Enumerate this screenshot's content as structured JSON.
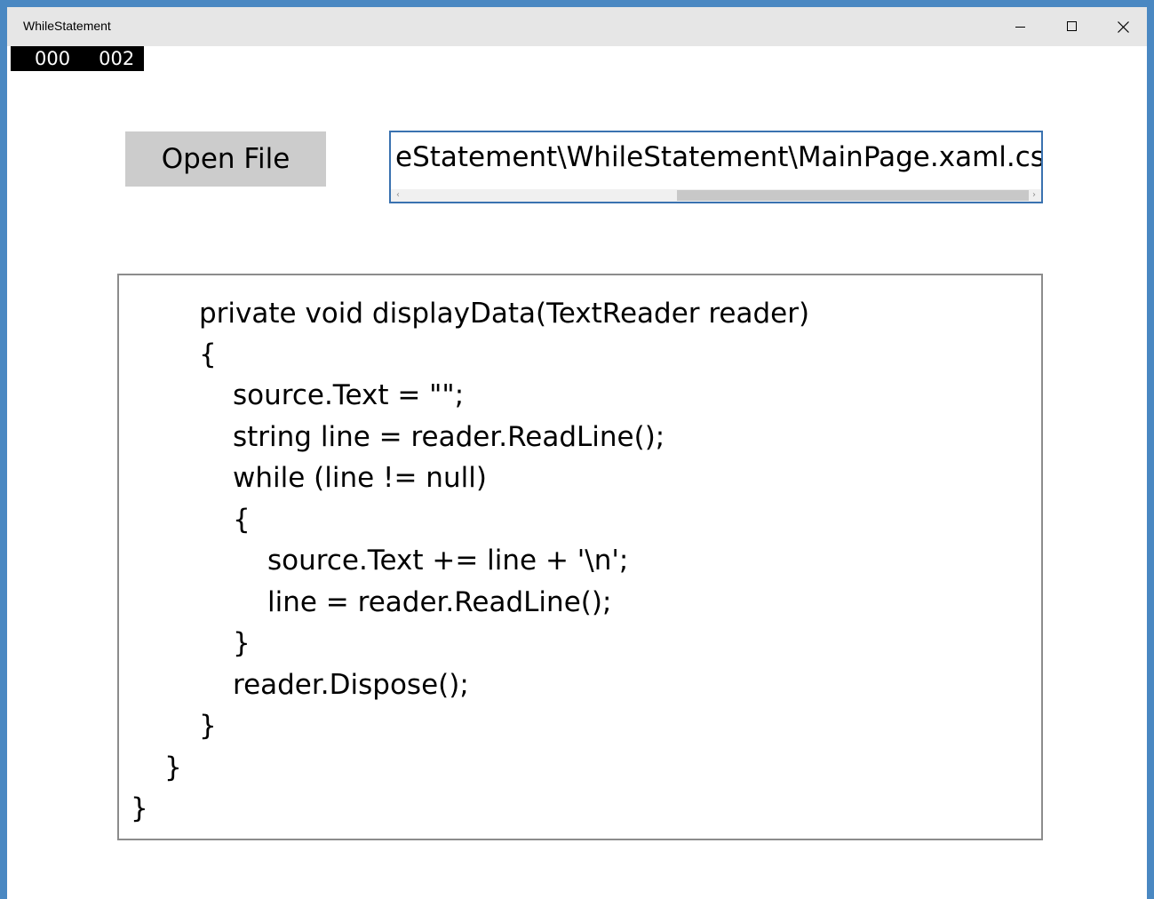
{
  "window": {
    "title": "WhileStatement"
  },
  "caption_buttons": {
    "minimize_icon": "minimize-icon",
    "maximize_icon": "maximize-icon",
    "close_icon": "close-icon"
  },
  "frame_counter": {
    "left_value": "000",
    "right_value": "002"
  },
  "toolbar": {
    "open_file_label": "Open File"
  },
  "file_path": {
    "value": "eStatement\\WhileStatement\\MainPage.xaml.cs"
  },
  "code": {
    "lines": [
      "private void displayData(TextReader reader)",
      "{",
      "source.Text = \"\";",
      "string line = reader.ReadLine();",
      "while (line != null)",
      "{",
      "source.Text += line + '\\n';",
      "line = reader.ReadLine();",
      "}",
      "reader.Dispose();",
      "}",
      "}",
      "}"
    ]
  },
  "colors": {
    "window_border": "#4a88c2",
    "titlebar": "#e6e6e6",
    "button_bg": "#cccccc",
    "textbox_border": "#3a72b0"
  }
}
